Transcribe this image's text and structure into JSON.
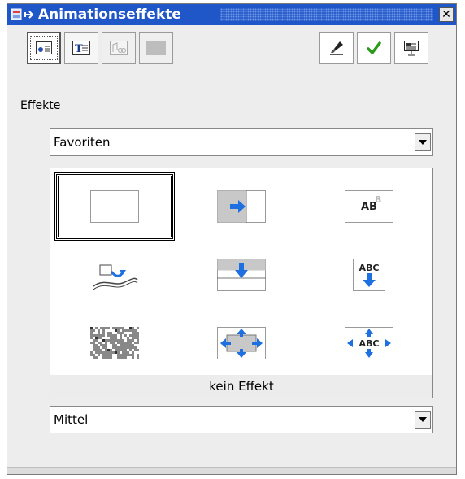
{
  "window": {
    "title": "Animationseffekte",
    "close_label": "✕"
  },
  "toolbar_left": [
    {
      "name": "effects-button",
      "icon": "effects-icon",
      "state": "pressed"
    },
    {
      "name": "text-effects-button",
      "icon": "text-effects-icon",
      "state": "normal"
    },
    {
      "name": "other-effects-button",
      "icon": "other-effects-icon",
      "state": "disabled"
    },
    {
      "name": "blank-button",
      "icon": "blank-icon",
      "state": "disabled"
    }
  ],
  "toolbar_right": [
    {
      "name": "extras-button",
      "icon": "brush-icon"
    },
    {
      "name": "assign-button",
      "icon": "checkmark-icon"
    },
    {
      "name": "preview-button",
      "icon": "presentation-icon"
    }
  ],
  "effects_section": {
    "label": "Effekte"
  },
  "category_select": {
    "value": "Favoriten"
  },
  "gallery": {
    "items": [
      {
        "name": "no-effect-item",
        "icon": "blank-slide-icon",
        "selected": true
      },
      {
        "name": "fly-in-right-item",
        "icon": "arrow-right-icon",
        "selected": false
      },
      {
        "name": "text-fade-item",
        "icon": "ab-fade-icon",
        "selected": false,
        "text": "AB"
      },
      {
        "name": "move-along-curve-item",
        "icon": "curve-move-icon",
        "selected": false
      },
      {
        "name": "fly-in-top-item",
        "icon": "arrow-down-icon",
        "selected": false
      },
      {
        "name": "text-fly-down-item",
        "icon": "abc-down-icon",
        "selected": false,
        "text": "ABC"
      },
      {
        "name": "dissolve-item",
        "icon": "dissolve-icon",
        "selected": false
      },
      {
        "name": "stretch-out-item",
        "icon": "stretch-arrows-icon",
        "selected": false
      },
      {
        "name": "text-stretch-item",
        "icon": "abc-stretch-icon",
        "selected": false,
        "text": "ABC"
      }
    ],
    "effect_name": "kein Effekt"
  },
  "speed_select": {
    "value": "Mittel"
  },
  "colors": {
    "titlebar": "#1f56c8",
    "arrow_blue": "#1e6fe0",
    "check_green": "#2a9a1a"
  }
}
